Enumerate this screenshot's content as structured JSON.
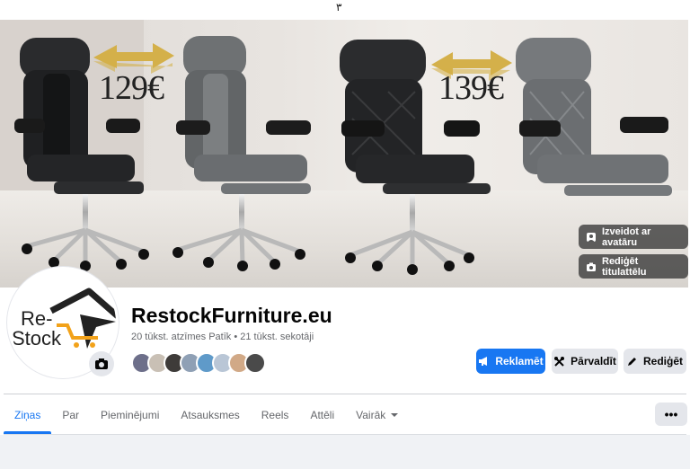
{
  "top_glyph": "٣",
  "cover": {
    "price_left": "129€",
    "price_right": "139€",
    "btn_avatar": "Izveidot ar avatāru",
    "btn_edit_cover": "Rediģēt titulattēlu"
  },
  "profile": {
    "logo_text_top": "Re-",
    "logo_text_bottom": "Stock",
    "name": "RestockFurniture.eu",
    "stats": "20 tūkst. atzīmes Patīk • 21 tūkst. sekotāji",
    "follower_colors": [
      "#6d6f8a",
      "#c9c0b5",
      "#3e3b39",
      "#8fa0b5",
      "#5f9ac9",
      "#b9c6d6",
      "#d1a987",
      "#4a4a4a"
    ]
  },
  "actions": {
    "promote": "Reklamēt",
    "manage": "Pārvaldīt",
    "edit": "Rediģēt"
  },
  "tabs": [
    {
      "label": "Ziņas",
      "active": true
    },
    {
      "label": "Par",
      "active": false
    },
    {
      "label": "Pieminējumi",
      "active": false
    },
    {
      "label": "Atsauksmes",
      "active": false
    },
    {
      "label": "Reels",
      "active": false
    },
    {
      "label": "Attēli",
      "active": false
    },
    {
      "label": "Vairāk",
      "active": false
    }
  ],
  "more_menu": "•••",
  "colors": {
    "accent": "#1877f2",
    "secondary_bg": "#e4e6eb",
    "muted_text": "#65676b",
    "arrow_gold": "#d4b04a"
  }
}
